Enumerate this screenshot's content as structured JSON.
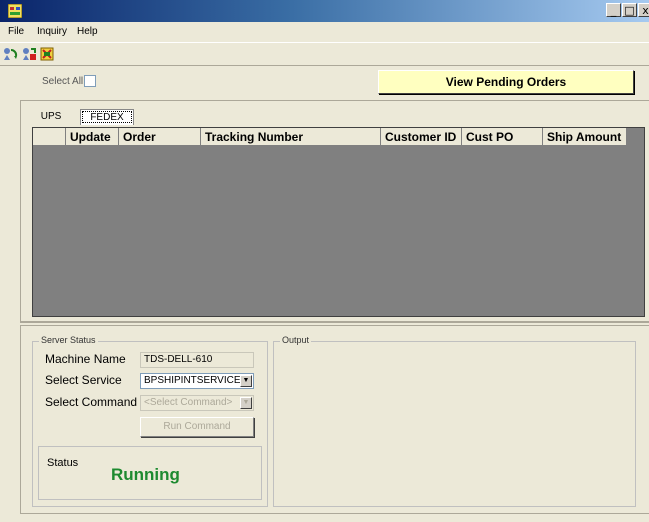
{
  "window": {
    "title": "",
    "controls": {
      "minimize": "_",
      "maximize": "□",
      "close": "x"
    }
  },
  "menu": {
    "items": [
      "File",
      "Inquiry",
      "Help"
    ]
  },
  "toolbar": {
    "icons": [
      "refresh-users-icon",
      "export-icon",
      "settings-icon"
    ]
  },
  "header": {
    "select_all_label": "Select All",
    "select_all_checked": false,
    "view_pending_label": "View Pending Orders"
  },
  "tabs": [
    {
      "label": "UPS",
      "active": false
    },
    {
      "label": "FEDEX",
      "active": true
    }
  ],
  "grid": {
    "columns": [
      "Update",
      "Order",
      "Tracking Number",
      "Customer ID",
      "Cust PO",
      "Ship Amount"
    ],
    "rows": []
  },
  "server_status": {
    "legend": "Server Status",
    "machine_name_label": "Machine Name",
    "machine_name_value": "TDS-DELL-610",
    "select_service_label": "Select Service",
    "select_service_value": "BPSHIPINTSERVICE",
    "select_command_label": "Select Command",
    "select_command_value": "<Select Command>",
    "run_command_label": "Run Command",
    "status_label": "Status",
    "status_value": "Running"
  },
  "output": {
    "legend": "Output"
  },
  "colors": {
    "status_running": "#1d8a2f",
    "pending_button_bg": "#ffffc0",
    "grid_bg": "#808080"
  }
}
